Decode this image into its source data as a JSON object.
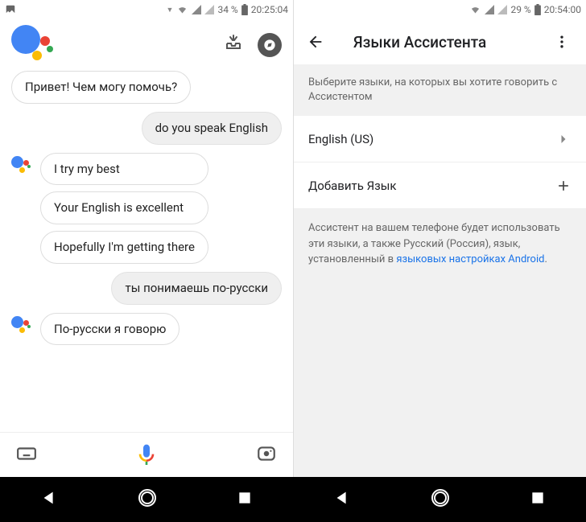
{
  "left": {
    "status": {
      "battery": "34 %",
      "time": "20:25:04"
    },
    "messages": [
      {
        "from": "assistant",
        "withLogo": false,
        "texts": [
          "Привет! Чем могу помочь?"
        ]
      },
      {
        "from": "user",
        "texts": [
          "do you speak English"
        ]
      },
      {
        "from": "assistant",
        "withLogo": true,
        "texts": [
          "I try my best",
          "Your English is excellent",
          "Hopefully I'm getting there"
        ]
      },
      {
        "from": "user",
        "texts": [
          "ты понимаешь по-русски"
        ]
      },
      {
        "from": "assistant",
        "withLogo": true,
        "texts": [
          "По-русски я говорю"
        ]
      }
    ]
  },
  "right": {
    "status": {
      "battery": "29 %",
      "time": "20:54:00"
    },
    "title": "Языки Ассистента",
    "section_label": "Выберите языки, на которых вы хотите говорить с Ассистентом",
    "items": {
      "primary": "English (US)",
      "add": "Добавить Язык"
    },
    "info_prefix": "Ассистент на вашем телефоне будет использовать эти языки, а также Русский (Россия), язык, установленный в ",
    "info_link": "языковых настройках Android",
    "info_suffix": "."
  }
}
